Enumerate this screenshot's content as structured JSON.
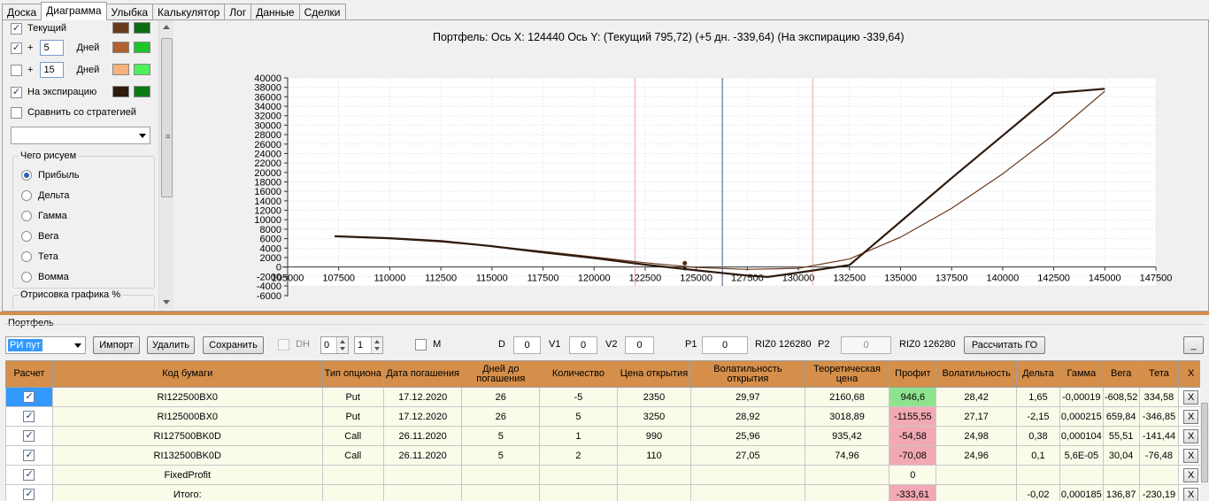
{
  "tabs": [
    "Доска",
    "Диаграмма",
    "Улыбка",
    "Калькулятор",
    "Лог",
    "Данные",
    "Сделки"
  ],
  "active_tab": "Диаграмма",
  "left": {
    "current": {
      "label": "Текущий",
      "checked": true,
      "colors": [
        "#6b3a1e",
        "#0a6b12"
      ]
    },
    "plus5": {
      "prefix": "+",
      "value": "5",
      "unit": "Дней",
      "checked": true,
      "colors": [
        "#b0612f",
        "#1fc32b"
      ]
    },
    "plus15": {
      "prefix": "+",
      "value": "15",
      "unit": "Дней",
      "checked": false,
      "colors": [
        "#f6b27a",
        "#4ef05a"
      ]
    },
    "expiry": {
      "label": "На экспирацию",
      "checked": true,
      "colors": [
        "#2e1a0e",
        "#0b7a14"
      ]
    },
    "compare": {
      "label": "Сравнить со стратегией",
      "checked": false
    },
    "group_title": "Чего рисуем",
    "radios": [
      "Прибыль",
      "Дельта",
      "Гамма",
      "Вега",
      "Тета",
      "Вомма"
    ],
    "radio_selected": "Прибыль",
    "group2_title": "Отрисовка графика %"
  },
  "chart": {
    "title": "Портфель:  Ось X:  124440  Ось Y:   (Текущий 795,72)   (+5 дн. -339,64)   (На экспирацию -339,64)"
  },
  "chart_data": {
    "type": "line",
    "x_ticks": [
      105000,
      107500,
      110000,
      112500,
      115000,
      117500,
      120000,
      122500,
      125000,
      127500,
      130000,
      132500,
      135000,
      137500,
      140000,
      142500,
      145000,
      147500
    ],
    "y_ticks": [
      -6000,
      -4000,
      -2000,
      0,
      2000,
      4000,
      6000,
      8000,
      10000,
      12000,
      14000,
      16000,
      18000,
      20000,
      22000,
      24000,
      26000,
      28000,
      30000,
      32000,
      34000,
      36000,
      38000,
      40000
    ],
    "xlim": [
      105000,
      147500
    ],
    "ylim": [
      -4000,
      40000
    ],
    "vertical_lines": {
      "current_price": 126280,
      "red_left": 122000,
      "red_right": 130700
    },
    "cursor_point": {
      "x": 124440,
      "y": 795.72
    },
    "series": [
      {
        "color": "#6b3a1e",
        "width": 1.2,
        "points": [
          [
            107300,
            6500
          ],
          [
            110000,
            6000
          ],
          [
            112500,
            5300
          ],
          [
            115000,
            4400
          ],
          [
            117500,
            3300
          ],
          [
            120000,
            2100
          ],
          [
            122500,
            900
          ],
          [
            125000,
            -80
          ],
          [
            127500,
            -500
          ],
          [
            130000,
            -280
          ],
          [
            132500,
            1700
          ],
          [
            135000,
            6300
          ],
          [
            137500,
            12400
          ],
          [
            140000,
            19700
          ],
          [
            142500,
            28000
          ],
          [
            145000,
            37200
          ]
        ]
      },
      {
        "color": "#2e1a0e",
        "width": 2.2,
        "points": [
          [
            107300,
            6500
          ],
          [
            110000,
            6100
          ],
          [
            112500,
            5500
          ],
          [
            115000,
            4400
          ],
          [
            117500,
            3100
          ],
          [
            120000,
            1900
          ],
          [
            122500,
            500
          ],
          [
            125000,
            -700
          ],
          [
            127500,
            -1800
          ],
          [
            128500,
            -2100
          ],
          [
            130000,
            -1200
          ],
          [
            132500,
            400
          ],
          [
            135000,
            9600
          ],
          [
            137500,
            18800
          ],
          [
            140000,
            27800
          ],
          [
            142500,
            36800
          ],
          [
            145000,
            37700
          ]
        ]
      }
    ]
  },
  "portfolio": {
    "label": "Портфель",
    "combo_value": "РИ пут",
    "import_label": "Импорт",
    "delete_label": "Удалить",
    "save_label": "Сохранить",
    "dh_label": "DH",
    "spin1": "0",
    "spin2": "1",
    "m_label": "M",
    "d_label": "D",
    "d_value": "0",
    "v1_label": "V1",
    "v1_value": "0",
    "v2_label": "V2",
    "v2_value": "0",
    "p1_label": "P1",
    "p1_value": "0",
    "riz1": "RIZ0 126280",
    "p2_label": "P2",
    "p2_value": "0",
    "riz2": "RIZ0 126280",
    "calc_label": "Рассчитать ГО",
    "min_label": "_"
  },
  "table": {
    "headers": [
      "Расчет",
      "Код бумаги",
      "Тип опциона",
      "Дата погашения",
      "Дней до погашения",
      "Количество",
      "Цена открытия",
      "Волатильность открытия",
      "Теоретическая цена",
      "Профит",
      "Волатильность",
      "Дельта",
      "Гамма",
      "Вега",
      "Тета",
      "X"
    ],
    "rows": [
      {
        "code": "RI122500BX0",
        "type": "Put",
        "date": "17.12.2020",
        "days": "26",
        "qty": "-5",
        "price": "2350",
        "vol_open": "29,97",
        "theo": "2160,68",
        "profit": "946,6",
        "ptype": "pos",
        "vol": "28,42",
        "delta": "1,65",
        "gamma": "-0,00019",
        "vega": "-608,52",
        "theta": "334,58",
        "x": "X"
      },
      {
        "code": "RI125000BX0",
        "type": "Put",
        "date": "17.12.2020",
        "days": "26",
        "qty": "5",
        "price": "3250",
        "vol_open": "28,92",
        "theo": "3018,89",
        "profit": "-1155,55",
        "ptype": "neg",
        "vol": "27,17",
        "delta": "-2,15",
        "gamma": "0,000215",
        "vega": "659,84",
        "theta": "-346,85",
        "x": "X"
      },
      {
        "code": "RI127500BK0D",
        "type": "Call",
        "date": "26.11.2020",
        "days": "5",
        "qty": "1",
        "price": "990",
        "vol_open": "25,96",
        "theo": "935,42",
        "profit": "-54,58",
        "ptype": "neg",
        "vol": "24,98",
        "delta": "0,38",
        "gamma": "0,000104",
        "vega": "55,51",
        "theta": "-141,44",
        "x": "X"
      },
      {
        "code": "RI132500BK0D",
        "type": "Call",
        "date": "26.11.2020",
        "days": "5",
        "qty": "2",
        "price": "110",
        "vol_open": "27,05",
        "theo": "74,96",
        "profit": "-70,08",
        "ptype": "neg",
        "vol": "24,96",
        "delta": "0,1",
        "gamma": "5,6E-05",
        "vega": "30,04",
        "theta": "-76,48",
        "x": "X"
      },
      {
        "code": "FixedProfit",
        "type": "",
        "date": "",
        "days": "",
        "qty": "",
        "price": "",
        "vol_open": "",
        "theo": "",
        "profit": "0",
        "ptype": "",
        "vol": "",
        "delta": "",
        "gamma": "",
        "vega": "",
        "theta": "",
        "x": "X"
      },
      {
        "code": "Итого:",
        "type": "",
        "date": "",
        "days": "",
        "qty": "",
        "price": "",
        "vol_open": "",
        "theo": "",
        "profit": "-333,61",
        "ptype": "neg",
        "vol": "",
        "delta": "-0,02",
        "gamma": "0,000185",
        "vega": "136,87",
        "theta": "-230,19",
        "x": "X"
      }
    ]
  }
}
